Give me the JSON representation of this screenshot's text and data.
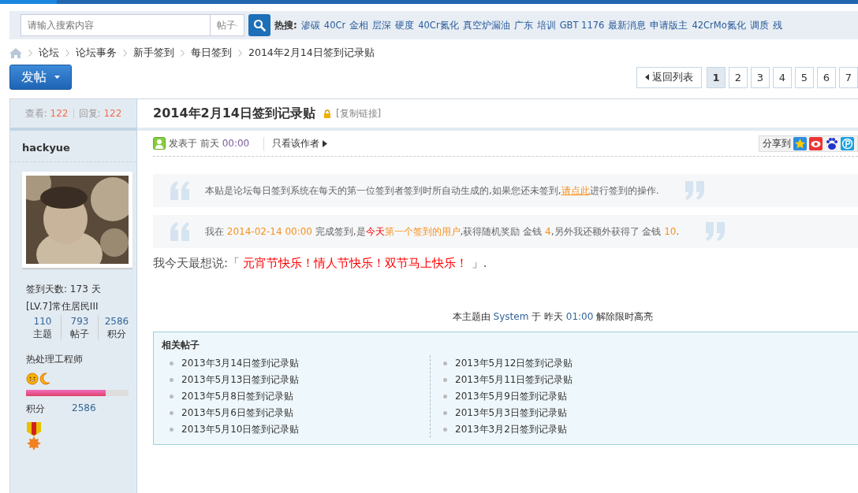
{
  "search": {
    "placeholder": "请输入搜索内容",
    "scope": "帖子",
    "hot_label": "热搜:",
    "hot_terms": [
      "渗碳",
      "40Cr",
      "金相",
      "层深",
      "硬度",
      "40Cr氮化",
      "真空炉漏油",
      "广东",
      "培训",
      "GBT 1176",
      "最新消息",
      "申请版主",
      "42CrMo氮化",
      "调质",
      "残"
    ]
  },
  "breadcrumb": [
    "论坛",
    "论坛事务",
    "新手签到",
    "每日签到",
    "2014年2月14日签到记录贴"
  ],
  "post_button": "发帖",
  "back_button": "返回列表",
  "pages": [
    {
      "label": "1",
      "selected": true
    },
    {
      "label": "2",
      "selected": false
    },
    {
      "label": "3",
      "selected": false
    },
    {
      "label": "4",
      "selected": false
    },
    {
      "label": "5",
      "selected": false
    },
    {
      "label": "6",
      "selected": false
    },
    {
      "label": "7",
      "selected": false
    }
  ],
  "stats": {
    "views_label": "查看:",
    "views": "122",
    "replies_label": "回复:",
    "replies": "122"
  },
  "author": {
    "name": "hackyue",
    "checkin_days": "签到天数: 173 天",
    "level": "[LV.7]常住居民III",
    "counts": [
      {
        "value": "110",
        "label": "主题"
      },
      {
        "value": "793",
        "label": "帖子"
      },
      {
        "value": "2586",
        "label": "积分"
      }
    ],
    "title": "热处理工程师",
    "level_bar": {
      "level": 0.78
    },
    "points_label": "积分",
    "points": "2586"
  },
  "thread": {
    "title": "2014年2月14日签到记录贴",
    "copy_link": "[复制链接]",
    "posted": "发表于 前天",
    "posted_time": "00:00",
    "author_only": "只看该作者",
    "share_label": "分享到"
  },
  "quotes": [
    {
      "segments": [
        {
          "kind": "plain",
          "text": "本贴是论坛每日签到系统在每天的第一位签到者签到时所自动生成的,如果您还未签到,"
        },
        {
          "kind": "link",
          "text": "请点此"
        },
        {
          "kind": "plain",
          "text": "进行签到的操作."
        }
      ]
    },
    {
      "segments": [
        {
          "kind": "plain",
          "text": "我在 "
        },
        {
          "kind": "orange",
          "text": "2014-02-14 00:00"
        },
        {
          "kind": "plain",
          "text": " 完成签到,是"
        },
        {
          "kind": "red",
          "text": "今天"
        },
        {
          "kind": "orange",
          "text": "第一个签到的用户"
        },
        {
          "kind": "plain",
          "text": ",获得随机奖励 金钱 "
        },
        {
          "kind": "orange",
          "text": "4"
        },
        {
          "kind": "plain",
          "text": ",另外我还额外获得了 金钱 "
        },
        {
          "kind": "orange",
          "text": "10"
        },
        {
          "kind": "plain",
          "text": "."
        }
      ]
    }
  ],
  "message": {
    "lead": "我今天最想说:「",
    "text": "元宵节快乐！情人节快乐！双节马上快乐！",
    "tail": "」."
  },
  "moderation": [
    {
      "kind": "plain",
      "text": "本主题由 "
    },
    {
      "kind": "blue",
      "text": "System"
    },
    {
      "kind": "plain",
      "text": " 于 昨天 "
    },
    {
      "kind": "blue",
      "text": "01:00"
    },
    {
      "kind": "plain",
      "text": " 解除限时高亮"
    }
  ],
  "related": {
    "title": "相关帖子",
    "columns": [
      [
        "2013年3月14日签到记录贴",
        "2013年5月13日签到记录贴",
        "2013年5月8日签到记录贴",
        "2013年5月6日签到记录贴",
        "2013年5月10日签到记录贴"
      ],
      [
        "2013年5月12日签到记录贴",
        "2013年5月11日签到记录贴",
        "2013年5月9日签到记录贴",
        "2013年5月3日签到记录贴",
        "2013年3月2日签到记录贴"
      ]
    ]
  }
}
